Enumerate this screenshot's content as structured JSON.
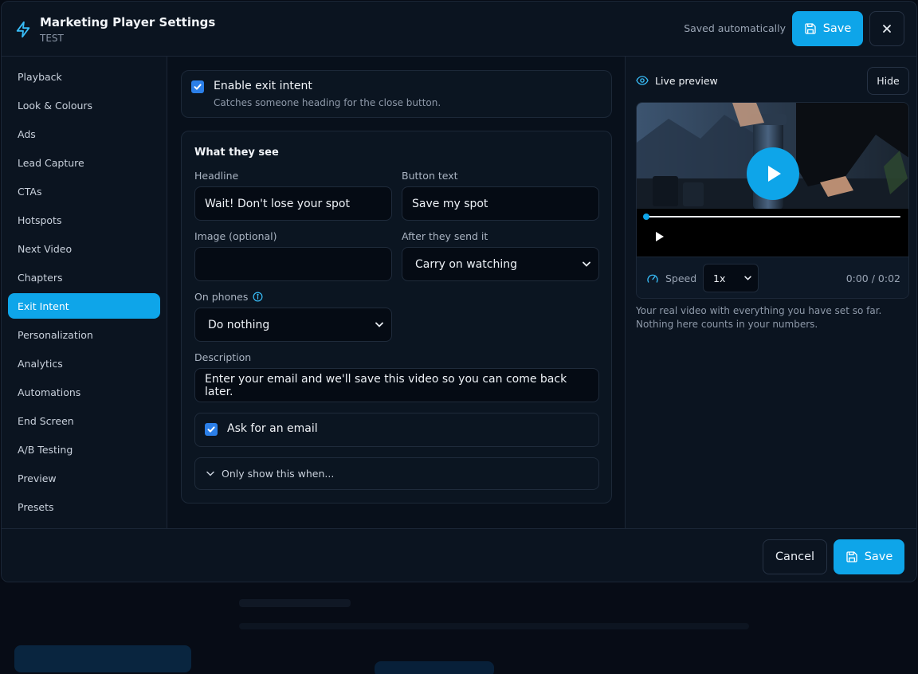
{
  "header": {
    "title": "Marketing Player Settings",
    "subtitle": "TEST",
    "saved_status": "Saved automatically",
    "save_label": "Save"
  },
  "sidebar": {
    "items": [
      {
        "label": "Playback"
      },
      {
        "label": "Look & Colours"
      },
      {
        "label": "Ads"
      },
      {
        "label": "Lead Capture"
      },
      {
        "label": "CTAs"
      },
      {
        "label": "Hotspots"
      },
      {
        "label": "Next Video"
      },
      {
        "label": "Chapters"
      },
      {
        "label": "Exit Intent",
        "active": true
      },
      {
        "label": "Personalization"
      },
      {
        "label": "Analytics"
      },
      {
        "label": "Automations"
      },
      {
        "label": "End Screen"
      },
      {
        "label": "A/B Testing"
      },
      {
        "label": "Preview"
      },
      {
        "label": "Presets"
      }
    ]
  },
  "exit_intent": {
    "enable_label": "Enable exit intent",
    "enable_help": "Catches someone heading for the close button.",
    "enabled": true
  },
  "what_they_see": {
    "section_title": "What they see",
    "headline_label": "Headline",
    "headline_value": "Wait! Don't lose your spot",
    "button_text_label": "Button text",
    "button_text_value": "Save my spot",
    "image_label": "Image (optional)",
    "image_value": "",
    "after_send_label": "After they send it",
    "after_send_value": "Carry on watching",
    "on_phones_label": "On phones",
    "on_phones_value": "Do nothing",
    "description_label": "Description",
    "description_value": "Enter your email and we'll save this video so you can come back later.",
    "ask_email_label": "Ask for an email",
    "ask_email_checked": true,
    "conditions_label": "Only show this when..."
  },
  "preview": {
    "title": "Live preview",
    "hide_label": "Hide",
    "speed_label": "Speed",
    "speed_value": "1x",
    "time": "0:00 / 0:02",
    "progress": 0,
    "note": "Your real video with everything you have set so far. Nothing here counts in your numbers."
  },
  "footer": {
    "cancel_label": "Cancel",
    "save_label": "Save"
  },
  "colors": {
    "accent": "#0ea5e9",
    "checkbox": "#2b7fe8",
    "background": "#0b1420"
  }
}
